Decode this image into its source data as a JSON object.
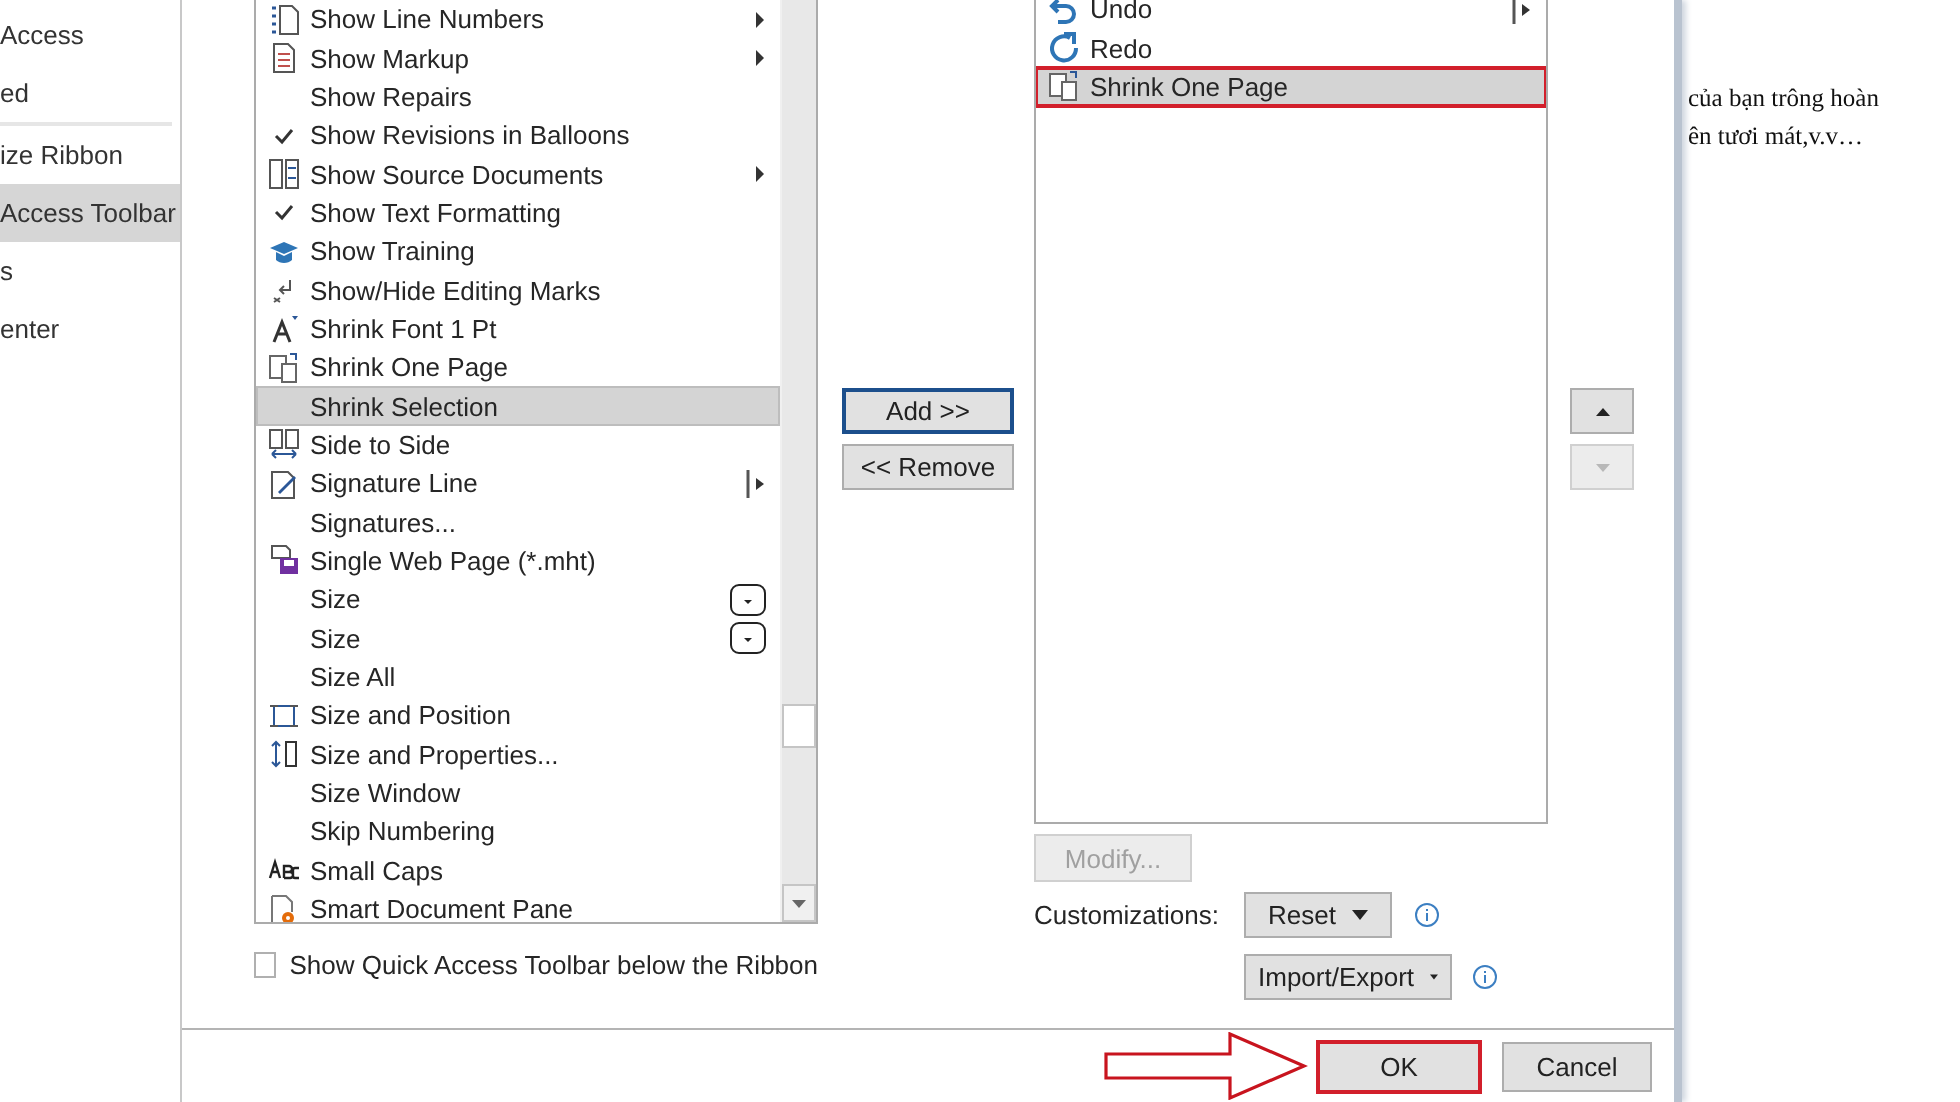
{
  "sidebar": {
    "groups": [
      {
        "items": [
          {
            "label": "Access",
            "selected": false
          },
          {
            "label": "ed",
            "selected": false
          }
        ]
      },
      {
        "items": [
          {
            "label": "ize Ribbon",
            "selected": false
          },
          {
            "label": "Access Toolbar",
            "selected": true
          },
          {
            "label": "s",
            "selected": false
          },
          {
            "label": "enter",
            "selected": false
          }
        ]
      }
    ]
  },
  "commands": [
    {
      "label": "Show Line Numbers",
      "kind": "submenu",
      "selected": false
    },
    {
      "label": "Show Markup",
      "kind": "submenu",
      "selected": false
    },
    {
      "label": "Show Repairs",
      "kind": "plain",
      "selected": false
    },
    {
      "label": "Show Revisions in Balloons",
      "kind": "plain",
      "selected": false
    },
    {
      "label": "Show Source Documents",
      "kind": "submenu",
      "selected": false
    },
    {
      "label": "Show Text Formatting",
      "kind": "plain",
      "selected": false
    },
    {
      "label": "Show Training",
      "kind": "plain",
      "selected": false
    },
    {
      "label": "Show/Hide Editing Marks",
      "kind": "plain",
      "selected": false
    },
    {
      "label": "Shrink Font 1 Pt",
      "kind": "plain",
      "selected": false
    },
    {
      "label": "Shrink One Page",
      "kind": "plain",
      "selected": false
    },
    {
      "label": "Shrink Selection",
      "kind": "plain",
      "selected": true
    },
    {
      "label": "Side to Side",
      "kind": "plain",
      "selected": false
    },
    {
      "label": "Signature Line",
      "kind": "split",
      "selected": false
    },
    {
      "label": "Signatures...",
      "kind": "plain",
      "selected": false
    },
    {
      "label": "Single Web Page (*.mht)",
      "kind": "plain",
      "selected": false
    },
    {
      "label": "Size",
      "kind": "dropdown",
      "selected": false
    },
    {
      "label": "Size",
      "kind": "dropdown",
      "selected": false
    },
    {
      "label": "Size All",
      "kind": "plain",
      "selected": false
    },
    {
      "label": "Size and Position",
      "kind": "plain",
      "selected": false
    },
    {
      "label": "Size and Properties...",
      "kind": "plain",
      "selected": false
    },
    {
      "label": "Size Window",
      "kind": "plain",
      "selected": false
    },
    {
      "label": "Skip Numbering",
      "kind": "plain",
      "selected": false
    },
    {
      "label": "Small Caps",
      "kind": "plain",
      "selected": false
    },
    {
      "label": "Smart Document Pane",
      "kind": "plain",
      "selected": false
    }
  ],
  "below_ribbon_checkbox": {
    "label": "Show Quick Access Toolbar below the Ribbon",
    "checked": false
  },
  "add_button": {
    "label": "Add >>",
    "focused": true
  },
  "remove_button": {
    "label": "<< Remove",
    "focused": false
  },
  "toolbar_items": [
    {
      "label": "Undo",
      "kind": "split",
      "selected": false,
      "highlighted": false
    },
    {
      "label": "Redo",
      "kind": "plain",
      "selected": false,
      "highlighted": false
    },
    {
      "label": "Shrink One Page",
      "kind": "plain",
      "selected": true,
      "highlighted": true
    }
  ],
  "move_buttons": [
    {
      "kind": "up",
      "disabled": false
    },
    {
      "kind": "down",
      "disabled": true
    }
  ],
  "modify_button": {
    "label": "Modify...",
    "disabled": true
  },
  "customizations": {
    "label": "Customizations:",
    "reset": "Reset",
    "import_export": "Import/Export"
  },
  "footer_buttons": [
    {
      "label": "OK",
      "highlighted": true
    },
    {
      "label": "Cancel",
      "highlighted": false
    }
  ],
  "document": {
    "lines": [
      "của bạn trông hoàn",
      "ên tươi mát,v.v…"
    ]
  }
}
